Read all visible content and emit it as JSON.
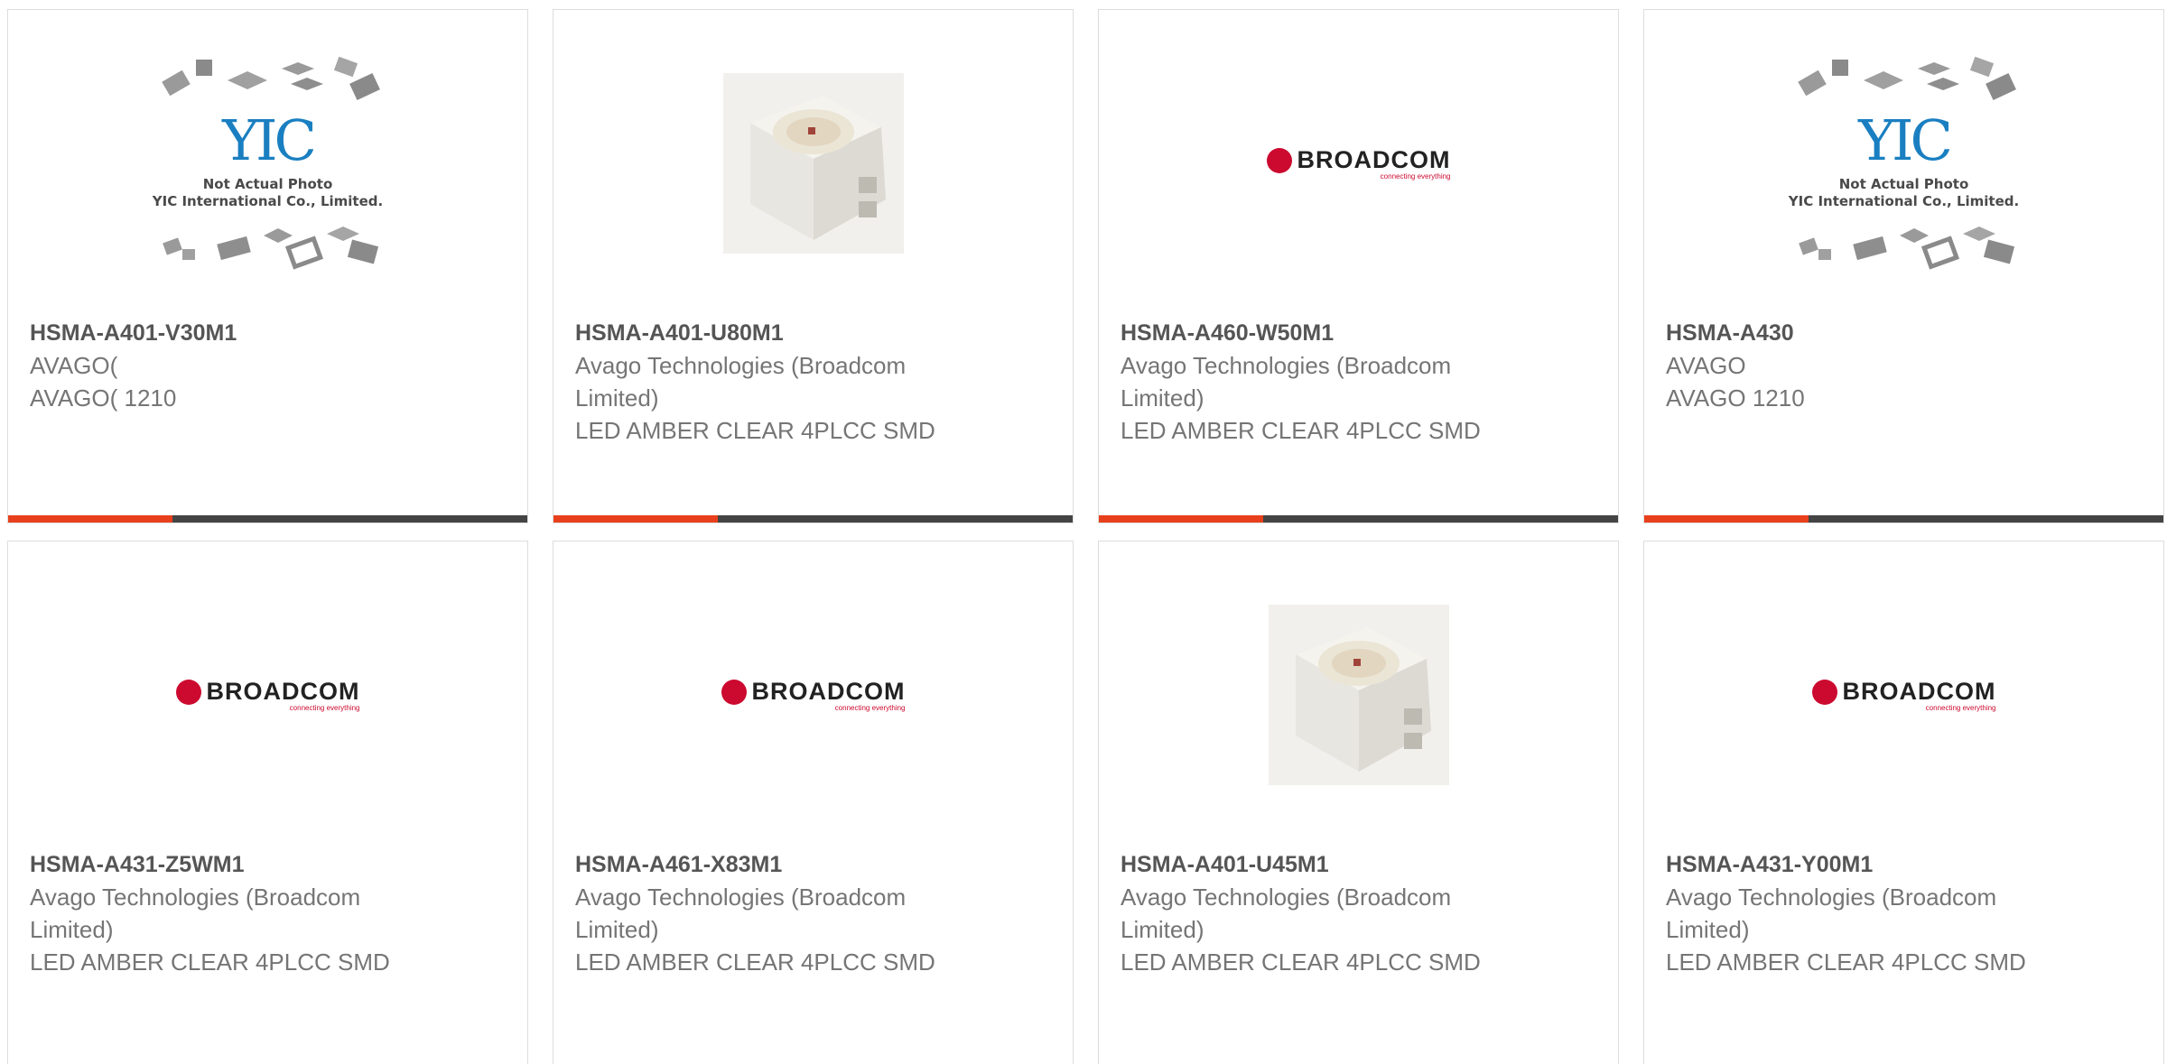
{
  "colors": {
    "accent": "#e8401c",
    "bar": "#444444",
    "broadcom_red": "#cc092f",
    "yic_blue": "#1a7fc1"
  },
  "placeholder": {
    "monogram": "YIC",
    "line1": "Not Actual Photo",
    "line2": "YIC International Co., Limited."
  },
  "broadcom": {
    "name": "BROADCOM",
    "tagline": "connecting everything"
  },
  "products": [
    {
      "part_number": "HSMA-A401-V30M1",
      "manufacturer": "AVAGO(",
      "description": "AVAGO( 1210",
      "image": "yic-placeholder"
    },
    {
      "part_number": "HSMA-A401-U80M1",
      "manufacturer": "Avago Technologies (Broadcom Limited)",
      "description": "LED AMBER CLEAR 4PLCC SMD",
      "image": "led-photo"
    },
    {
      "part_number": "HSMA-A460-W50M1",
      "manufacturer": "Avago Technologies (Broadcom Limited)",
      "description": "LED AMBER CLEAR 4PLCC SMD",
      "image": "broadcom-logo"
    },
    {
      "part_number": "HSMA-A430",
      "manufacturer": "AVAGO",
      "description": "AVAGO 1210",
      "image": "yic-placeholder"
    },
    {
      "part_number": "HSMA-A431-Z5WM1",
      "manufacturer": "Avago Technologies (Broadcom Limited)",
      "description": "LED AMBER CLEAR 4PLCC SMD",
      "image": "broadcom-logo"
    },
    {
      "part_number": "HSMA-A461-X83M1",
      "manufacturer": "Avago Technologies (Broadcom Limited)",
      "description": "LED AMBER CLEAR 4PLCC SMD",
      "image": "broadcom-logo"
    },
    {
      "part_number": "HSMA-A401-U45M1",
      "manufacturer": "Avago Technologies (Broadcom Limited)",
      "description": "LED AMBER CLEAR 4PLCC SMD",
      "image": "led-photo"
    },
    {
      "part_number": "HSMA-A431-Y00M1",
      "manufacturer": "Avago Technologies (Broadcom Limited)",
      "description": "LED AMBER CLEAR 4PLCC SMD",
      "image": "broadcom-logo"
    }
  ]
}
